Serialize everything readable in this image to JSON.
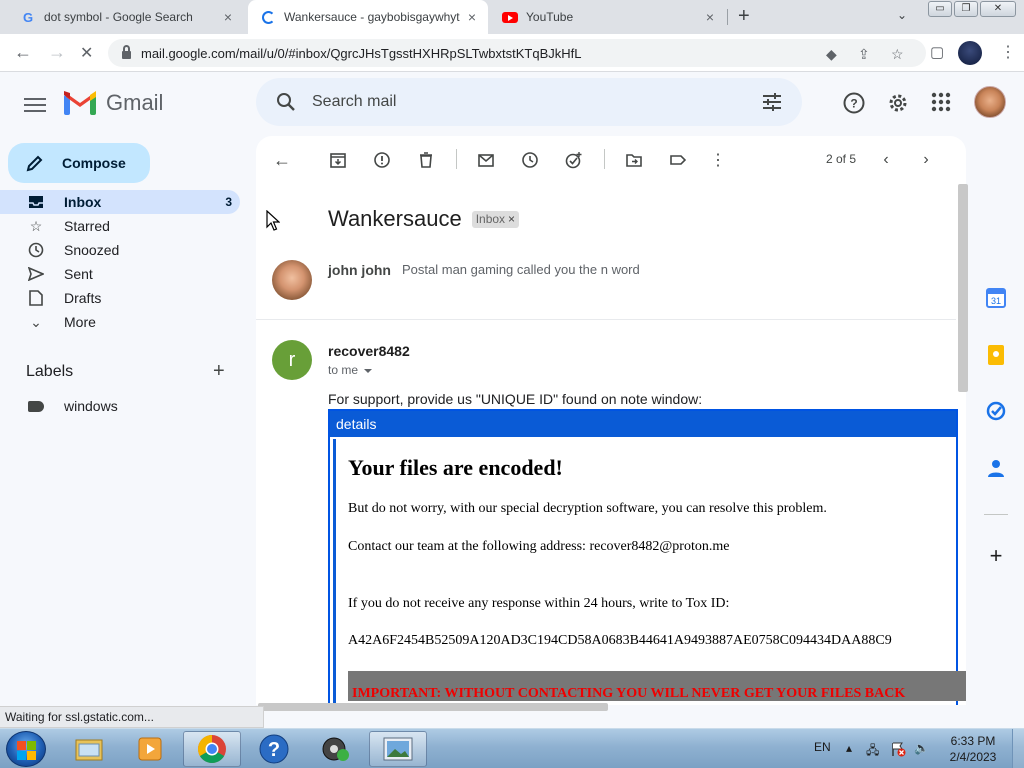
{
  "browser": {
    "tabs": [
      {
        "title": "dot symbol - Google Search",
        "icon": "google-icon",
        "close": "×"
      },
      {
        "title": "Wankersauce - gaybobisgaywhyt",
        "icon": "loading-spinner-icon",
        "close": "×"
      },
      {
        "title": "YouTube",
        "icon": "youtube-icon",
        "close": "×"
      }
    ],
    "new_tab": "+",
    "tab_dropdown": "⌄",
    "window": {
      "minimize": "▭",
      "restore": "❐",
      "close": "✕"
    },
    "url": "mail.google.com/mail/u/0/#inbox/QgrcJHsTgsstHXHRpSLTwbxtstKTqBJkHfL",
    "nav": {
      "back": "←",
      "forward": "→",
      "stop": "✕"
    }
  },
  "gmail": {
    "brand": "Gmail",
    "brand_colors": {
      "red": "#ea4335",
      "blue": "#4285f4",
      "green": "#34a853",
      "yellow": "#fbbc04"
    },
    "search_placeholder": "Search mail",
    "compose_label": "Compose",
    "nav": {
      "inbox": "Inbox",
      "inbox_count": "3",
      "starred": "Starred",
      "snoozed": "Snoozed",
      "sent": "Sent",
      "drafts": "Drafts",
      "more": "More"
    },
    "labels_title": "Labels",
    "labels_add": "+",
    "labels": [
      "windows"
    ],
    "pager": "2 of 5",
    "thread": {
      "subject": "Wankersauce",
      "chip": "Inbox",
      "chip_x": "×",
      "msg1": {
        "from": "john john",
        "snippet": "Postal man gaming called you the n word"
      },
      "msg2": {
        "initial": "r",
        "from": "recover8482",
        "to": "to me",
        "intro": "For support, provide us \"UNIQUE ID\" found on note window:"
      }
    },
    "details": {
      "bar_title": "details",
      "title": "Your files are encoded!",
      "p1": "But do not worry, with our special decryption software, you can resolve this problem.",
      "p2": "Contact our team at the following address: recover8482@proton.me",
      "p3": "If you do not receive any response within 24 hours, write to Tox ID:",
      "p4": "A42A6F2454B52509A120AD3C194CD58A0683B44641A9493887AE0758C094434DAA88C9",
      "warning": "IMPORTANT: WITHOUT CONTACTING YOU WILL NEVER GET YOUR FILES BACK"
    },
    "status_text": "Waiting for ssl.gstatic.com..."
  },
  "taskbar": {
    "language": "EN",
    "time": "6:33 PM",
    "date": "2/4/2023",
    "apps": [
      "file-explorer-icon",
      "media-player-icon",
      "chrome-icon",
      "help-icon",
      "media-center-icon",
      "photo-viewer-icon"
    ]
  },
  "side_panel": {
    "calendar_day": "31",
    "add": "+",
    "expand": "›"
  }
}
